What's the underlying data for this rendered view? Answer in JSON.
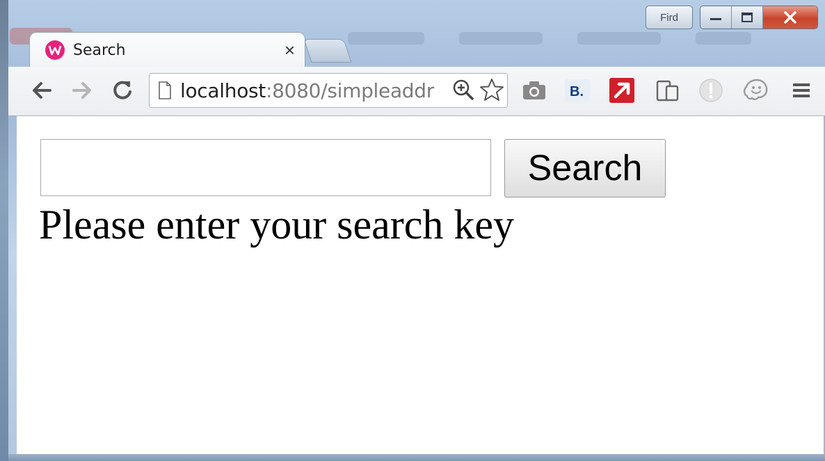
{
  "window": {
    "user_button_label": "Fird",
    "controls": {
      "minimize_icon": "minimize-icon",
      "maximize_icon": "maximize-icon",
      "close_icon": "close-icon"
    }
  },
  "tab": {
    "title": "Search",
    "favicon": "wamp-w-icon",
    "close_glyph": "×",
    "favicon_color": "#e6227d"
  },
  "toolbar": {
    "url_host": "localhost",
    "url_rest": ":8080/simpleaddr",
    "icons": [
      "back-arrow-icon",
      "forward-arrow-icon",
      "reload-icon",
      "page-icon",
      "zoom-icon",
      "bookmark-star-icon",
      "camera-icon",
      "bookmark-b-icon",
      "red-arrow-icon",
      "devices-icon",
      "disabled-extension-icon",
      "waze-icon",
      "menu-icon"
    ],
    "bookmark_b_label": "B."
  },
  "page": {
    "search_input_value": "",
    "search_button_label": "Search",
    "message": "Please enter your search key"
  }
}
